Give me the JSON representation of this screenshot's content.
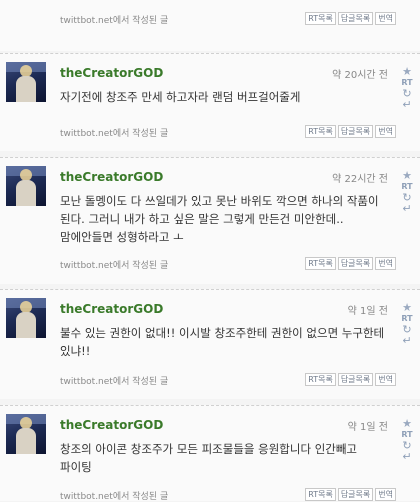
{
  "footer_label": "twittbot.net에서 작성된 글",
  "buttons": {
    "rt": "RT목록",
    "reply": "답글목록",
    "translate": "번역"
  },
  "side": {
    "star": "★",
    "rt": "RT",
    "retweet": "↻",
    "reply": "↵"
  },
  "top": {
    "footer_label": "twittbot.net에서 작성된 글"
  },
  "tweets": [
    {
      "user": "theCreatorGOD",
      "time": "약 20시간 전",
      "text": "자기전에 창조주 만세 하고자라 랜덤 버프걸어줄게"
    },
    {
      "user": "theCreatorGOD",
      "time": "약 22시간 전",
      "text": "모난 돌멩이도 다 쓰일데가 있고 못난 바위도 깍으면 하나의 작품이 된다. 그러니 내가 하고 싶은 말은 그렇게 만든건 미안한데.. 맘에안들면 성형하라고 ㅗ"
    },
    {
      "user": "theCreatorGOD",
      "time": "약 1일 전",
      "text": "불수 있는 권한이 없대!! 이시발 창조주한테 권한이 없으면 누구한테 있냐!!"
    },
    {
      "user": "theCreatorGOD",
      "time": "약 1일 전",
      "text": "창조의 아이콘 창조주가 모든 피조물들을 응원합니다 인간빼고 파이팅"
    }
  ]
}
